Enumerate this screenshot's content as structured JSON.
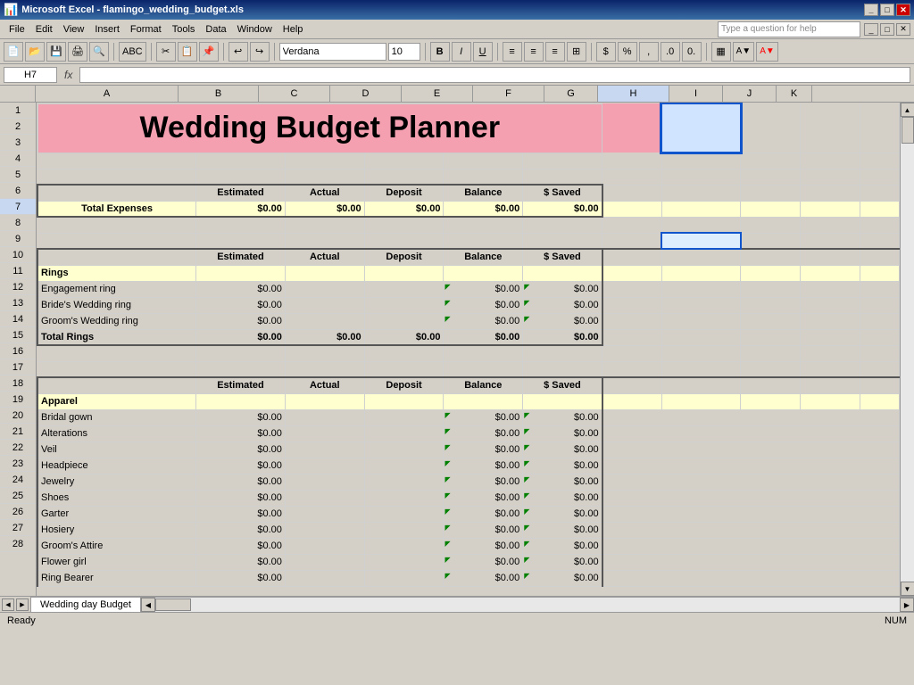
{
  "titlebar": {
    "title": "Microsoft Excel - flamingo_wedding_budget.xls",
    "icon": "excel-icon"
  },
  "menubar": {
    "items": [
      "File",
      "Edit",
      "View",
      "Insert",
      "Format",
      "Tools",
      "Data",
      "Window",
      "Help"
    ]
  },
  "toolbar": {
    "font_name": "Verdana",
    "font_size": "10",
    "help_placeholder": "Type a question for help"
  },
  "formula_bar": {
    "cell_ref": "H7",
    "formula": ""
  },
  "columns": {
    "headers": [
      "A",
      "B",
      "C",
      "D",
      "E",
      "F",
      "G",
      "H",
      "I",
      "J",
      "K"
    ]
  },
  "rows": {
    "numbers": [
      "1",
      "2",
      "3",
      "4",
      "5",
      "6",
      "7",
      "8",
      "9",
      "10",
      "11",
      "12",
      "13",
      "14",
      "15",
      "16",
      "17",
      "18",
      "19",
      "20",
      "21",
      "22",
      "23",
      "24",
      "25",
      "26",
      "27",
      "28"
    ]
  },
  "spreadsheet": {
    "title": "Wedding Budget Planner",
    "col_headers_row4": {
      "estimated": "Estimated",
      "actual": "Actual",
      "deposit": "Deposit",
      "balance": "Balance",
      "saved": "$ Saved"
    },
    "total_expenses": {
      "label": "Total Expenses",
      "estimated": "$0.00",
      "actual": "$0.00",
      "deposit": "$0.00",
      "balance": "$0.00",
      "saved": "$0.00"
    },
    "col_headers_row8": {
      "estimated": "Estimated",
      "actual": "Actual",
      "deposit": "Deposit",
      "balance": "Balance",
      "saved": "$ Saved"
    },
    "rings_section": {
      "header": "Rings",
      "items": [
        {
          "name": "Engagement ring",
          "estimated": "$0.00",
          "balance": "$0.00",
          "saved": "$0.00"
        },
        {
          "name": "Bride's Wedding ring",
          "estimated": "$0.00",
          "balance": "$0.00",
          "saved": "$0.00"
        },
        {
          "name": "Groom's Wedding ring",
          "estimated": "$0.00",
          "balance": "$0.00",
          "saved": "$0.00"
        }
      ],
      "total": {
        "label": "Total Rings",
        "estimated": "$0.00",
        "actual": "$0.00",
        "deposit": "$0.00",
        "balance": "$0.00",
        "saved": "$0.00"
      }
    },
    "col_headers_row16": {
      "estimated": "Estimated",
      "actual": "Actual",
      "deposit": "Deposit",
      "balance": "Balance",
      "saved": "$ Saved"
    },
    "apparel_section": {
      "header": "Apparel",
      "items": [
        {
          "name": "Bridal gown",
          "estimated": "$0.00",
          "balance": "$0.00",
          "saved": "$0.00"
        },
        {
          "name": "Alterations",
          "estimated": "$0.00",
          "balance": "$0.00",
          "saved": "$0.00"
        },
        {
          "name": "Veil",
          "estimated": "$0.00",
          "balance": "$0.00",
          "saved": "$0.00"
        },
        {
          "name": "Headpiece",
          "estimated": "$0.00",
          "balance": "$0.00",
          "saved": "$0.00"
        },
        {
          "name": "Jewelry",
          "estimated": "$0.00",
          "balance": "$0.00",
          "saved": "$0.00"
        },
        {
          "name": "Shoes",
          "estimated": "$0.00",
          "balance": "$0.00",
          "saved": "$0.00"
        },
        {
          "name": "Garter",
          "estimated": "$0.00",
          "balance": "$0.00",
          "saved": "$0.00"
        },
        {
          "name": "Hosiery",
          "estimated": "$0.00",
          "balance": "$0.00",
          "saved": "$0.00"
        },
        {
          "name": "Groom's Attire",
          "estimated": "$0.00",
          "balance": "$0.00",
          "saved": "$0.00"
        },
        {
          "name": "Flower girl",
          "estimated": "$0.00",
          "balance": "$0.00",
          "saved": "$0.00"
        },
        {
          "name": "Ring Bearer",
          "estimated": "$0.00",
          "balance": "$0.00",
          "saved": "$0.00"
        }
      ]
    }
  },
  "tabs": {
    "sheets": [
      "Wedding day Budget"
    ]
  },
  "statusbar": {
    "status": "Ready",
    "mode": "NUM"
  }
}
